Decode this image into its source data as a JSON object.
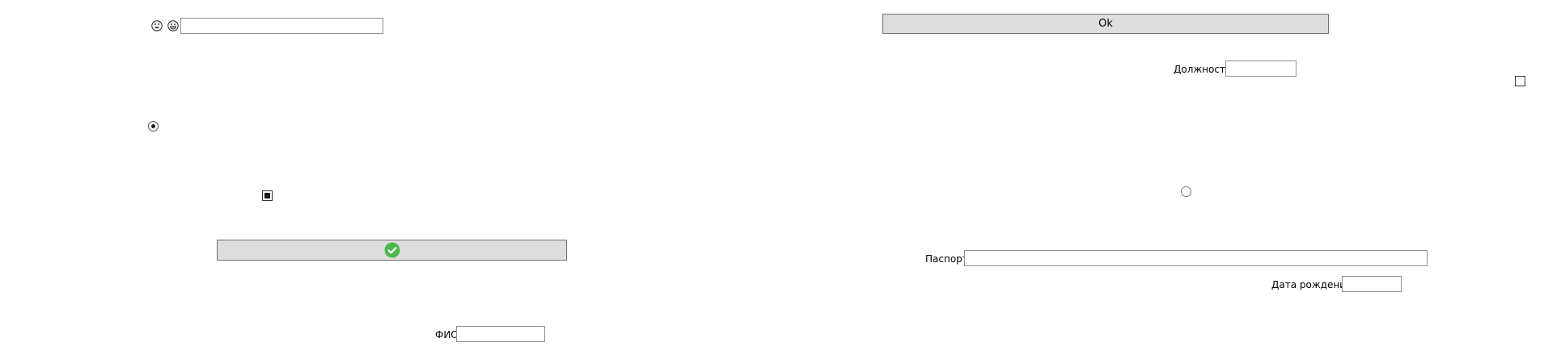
{
  "emoji_icons": [
    {
      "name": "star-struck-face-icon"
    },
    {
      "name": "grinning-face-icon"
    }
  ],
  "top_left_input": {
    "value": "",
    "placeholder": ""
  },
  "ok_button": {
    "label": "Ok"
  },
  "position_field": {
    "label": "Должность",
    "value": ""
  },
  "passport_field": {
    "label": "Паспорт",
    "value": ""
  },
  "birth_date_field": {
    "label": "Дата рождения",
    "value": ""
  },
  "fio_field": {
    "label": "ФИО",
    "value": ""
  },
  "radio_left": {
    "checked": true
  },
  "radio_right": {
    "checked": false
  },
  "checkbox_left": {
    "state": "indeterminate"
  },
  "checkbox_right": {
    "state": "unchecked"
  },
  "confirm_button": {
    "icon": "check-circle-icon"
  },
  "colors": {
    "button_bg": "#dddddd",
    "button_border": "#707070",
    "input_border": "#8e8f8f",
    "check_icon_green": "#4cb84c"
  }
}
